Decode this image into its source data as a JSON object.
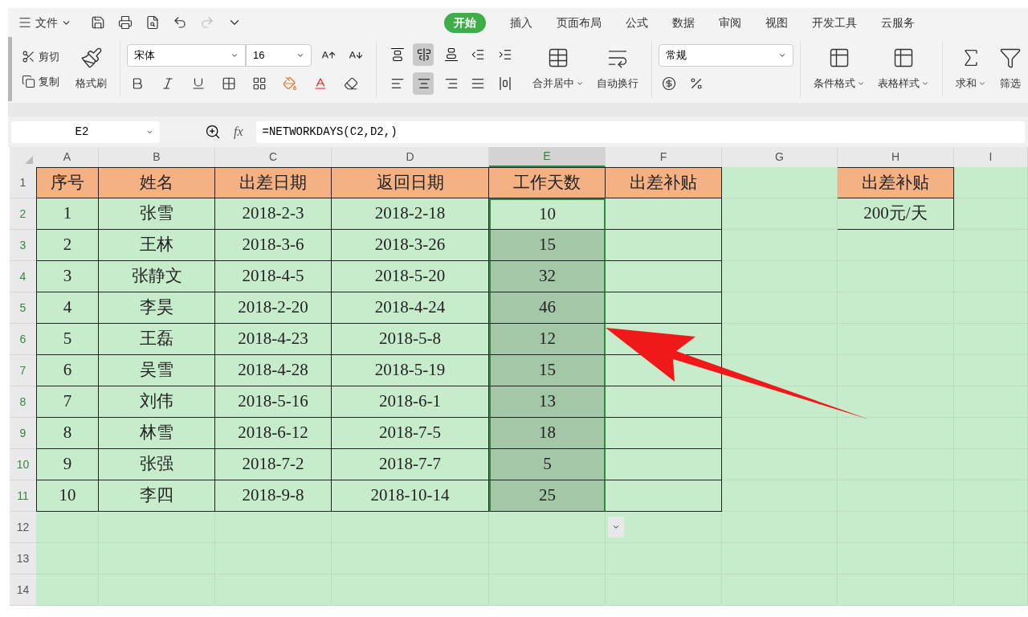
{
  "menu": {
    "label": "文件"
  },
  "tabs": [
    {
      "label": "开始",
      "selected": true
    },
    {
      "label": "插入",
      "selected": false
    },
    {
      "label": "页面布局",
      "selected": false
    },
    {
      "label": "公式",
      "selected": false
    },
    {
      "label": "数据",
      "selected": false
    },
    {
      "label": "审阅",
      "selected": false
    },
    {
      "label": "视图",
      "selected": false
    },
    {
      "label": "开发工具",
      "selected": false
    },
    {
      "label": "云服务",
      "selected": false
    }
  ],
  "ribbon": {
    "cut": "剪切",
    "copy": "复制",
    "format_painter": "格式刷",
    "font_name": "宋体",
    "font_size": "16",
    "alignment": [
      {
        "kind": "top",
        "selected": false
      },
      {
        "kind": "middle",
        "selected": true
      },
      {
        "kind": "bottom",
        "selected": false
      },
      {
        "kind": "outdent",
        "selected": false
      },
      {
        "kind": "indent",
        "selected": false
      },
      {
        "kind": "left",
        "selected": false
      },
      {
        "kind": "center",
        "selected": true
      },
      {
        "kind": "right",
        "selected": false
      },
      {
        "kind": "justify",
        "selected": false
      },
      {
        "kind": "distribute",
        "selected": false
      }
    ],
    "merge": "合并居中",
    "wrap": "自动换行",
    "number_format": "常规",
    "conditional_format": "条件格式",
    "table_style": "表格样式",
    "sum": "求和",
    "filter": "筛选"
  },
  "formula_bar": {
    "name_box": "E2",
    "function_label": "fx",
    "formula": "=NETWORKDAYS(C2,D2,)"
  },
  "columns": [
    {
      "label": "A",
      "selected": false
    },
    {
      "label": "B",
      "selected": false
    },
    {
      "label": "C",
      "selected": false
    },
    {
      "label": "D",
      "selected": false
    },
    {
      "label": "E",
      "selected": true
    },
    {
      "label": "F",
      "selected": false
    },
    {
      "label": "G",
      "selected": false
    },
    {
      "label": "H",
      "selected": false
    },
    {
      "label": "I",
      "selected": false
    }
  ],
  "rows": [
    {
      "label": "1",
      "kind": "header",
      "selected": false,
      "cells": {
        "A": "序号",
        "B": "姓名",
        "C": "出差日期",
        "D": "返回日期",
        "E": "工作天数",
        "F": "出差补贴",
        "H": "出差补贴"
      }
    },
    {
      "label": "2",
      "kind": "data",
      "selected": true,
      "active": true,
      "cells": {
        "A": "1",
        "B": "张雪",
        "C": "2018-2-3",
        "D": "2018-2-18",
        "E": "10",
        "H": "200元/天"
      }
    },
    {
      "label": "3",
      "kind": "data",
      "selected": true,
      "active": false,
      "cells": {
        "A": "2",
        "B": "王林",
        "C": "2018-3-6",
        "D": "2018-3-26",
        "E": "15"
      }
    },
    {
      "label": "4",
      "kind": "data",
      "selected": true,
      "active": false,
      "cells": {
        "A": "3",
        "B": "张静文",
        "C": "2018-4-5",
        "D": "2018-5-20",
        "E": "32"
      }
    },
    {
      "label": "5",
      "kind": "data",
      "selected": true,
      "active": false,
      "cells": {
        "A": "4",
        "B": "李昊",
        "C": "2018-2-20",
        "D": "2018-4-24",
        "E": "46"
      }
    },
    {
      "label": "6",
      "kind": "data",
      "selected": true,
      "active": false,
      "cells": {
        "A": "5",
        "B": "王磊",
        "C": "2018-4-23",
        "D": "2018-5-8",
        "E": "12"
      }
    },
    {
      "label": "7",
      "kind": "data",
      "selected": true,
      "active": false,
      "cells": {
        "A": "6",
        "B": "吴雪",
        "C": "2018-4-28",
        "D": "2018-5-19",
        "E": "15"
      }
    },
    {
      "label": "8",
      "kind": "data",
      "selected": true,
      "active": false,
      "cells": {
        "A": "7",
        "B": "刘伟",
        "C": "2018-5-16",
        "D": "2018-6-1",
        "E": "13"
      }
    },
    {
      "label": "9",
      "kind": "data",
      "selected": true,
      "active": false,
      "cells": {
        "A": "8",
        "B": "林雪",
        "C": "2018-6-12",
        "D": "2018-7-5",
        "E": "18"
      }
    },
    {
      "label": "10",
      "kind": "data",
      "selected": true,
      "active": false,
      "cells": {
        "A": "9",
        "B": "张强",
        "C": "2018-7-2",
        "D": "2018-7-7",
        "E": "5"
      }
    },
    {
      "label": "11",
      "kind": "data",
      "selected": true,
      "active": false,
      "cells": {
        "A": "10",
        "B": "李四",
        "C": "2018-9-8",
        "D": "2018-10-14",
        "E": "25"
      }
    }
  ],
  "blank_rows": [
    {
      "label": "12",
      "selected": false
    },
    {
      "label": "13",
      "selected": false
    },
    {
      "label": "14",
      "selected": false
    }
  ]
}
